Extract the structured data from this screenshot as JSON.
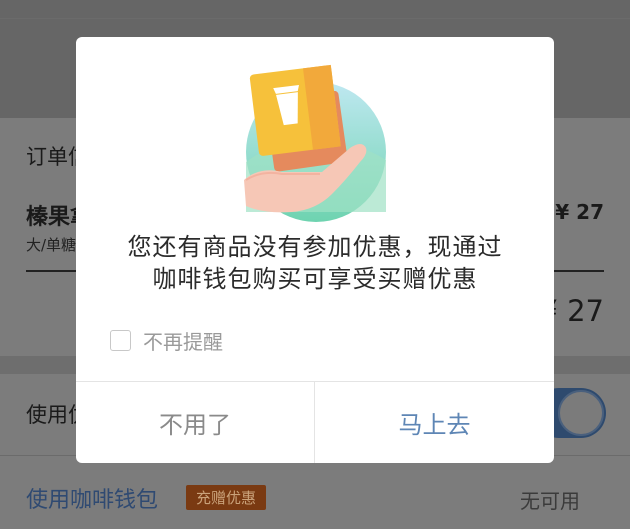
{
  "background": {
    "order_title": "订单信",
    "item": {
      "name": "榛果拿",
      "spec": "大/单糖",
      "price": "¥ 27"
    },
    "total_price": "¥ 27",
    "use_label": "使用优",
    "wallet": {
      "label": "使用咖啡钱包",
      "badge": "充赠优惠",
      "status": "无可用"
    }
  },
  "dialog": {
    "message_lines": [
      "您还有商品没有参加优惠，现通过",
      "咖啡钱包购买可享受买赠优惠"
    ],
    "checkbox_label": "不再提醒",
    "checkbox_checked": false,
    "cancel_label": "不用了",
    "confirm_label": "马上去",
    "illustration_icon": "hand-holding-coupon-cards-icon"
  },
  "colors": {
    "overlay": "#7b7b7b",
    "confirm_text": "#5e86b5",
    "cancel_text": "#8a8a8a",
    "badge_bg": "#7a3a12"
  }
}
